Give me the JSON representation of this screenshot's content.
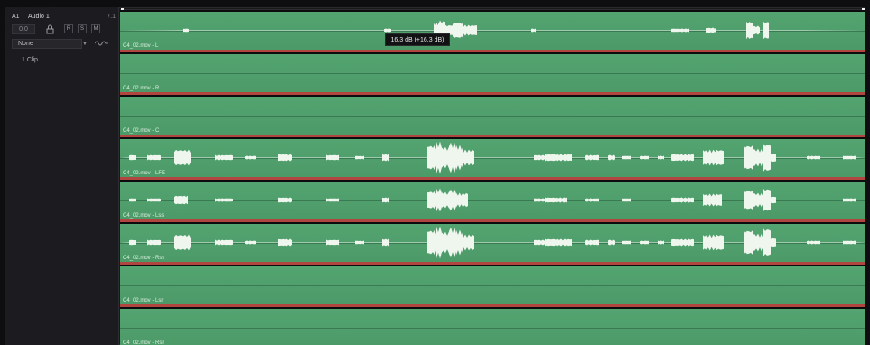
{
  "track": {
    "id": "A1",
    "name": "Audio 1",
    "format": "7.1",
    "volume": "0.0",
    "buttons": [
      "R",
      "S",
      "M"
    ],
    "effect_select": "None",
    "clip_count": "1 Clip"
  },
  "tooltip": "16.3 dB (+16.3 dB)",
  "lanes": [
    {
      "label": "C4_02.mov - L",
      "waveform": "light"
    },
    {
      "label": "C4_02.mov - R",
      "waveform": "flat"
    },
    {
      "label": "C4_02.mov - C",
      "waveform": "flat"
    },
    {
      "label": "C4_02.mov - LFE",
      "waveform": "full"
    },
    {
      "label": "C4_02.mov - Lss",
      "waveform": "medium"
    },
    {
      "label": "C4_02.mov - Rss",
      "waveform": "full"
    },
    {
      "label": "C4_02.mov - Lsr",
      "waveform": "flat"
    },
    {
      "label": "C4_02.mov - Rsr",
      "waveform": "flat"
    }
  ],
  "colors": {
    "lane_green": "#53a470",
    "redline": "#b14640",
    "waveform": "#eef6ee",
    "header_bg": "#1c1c20"
  }
}
